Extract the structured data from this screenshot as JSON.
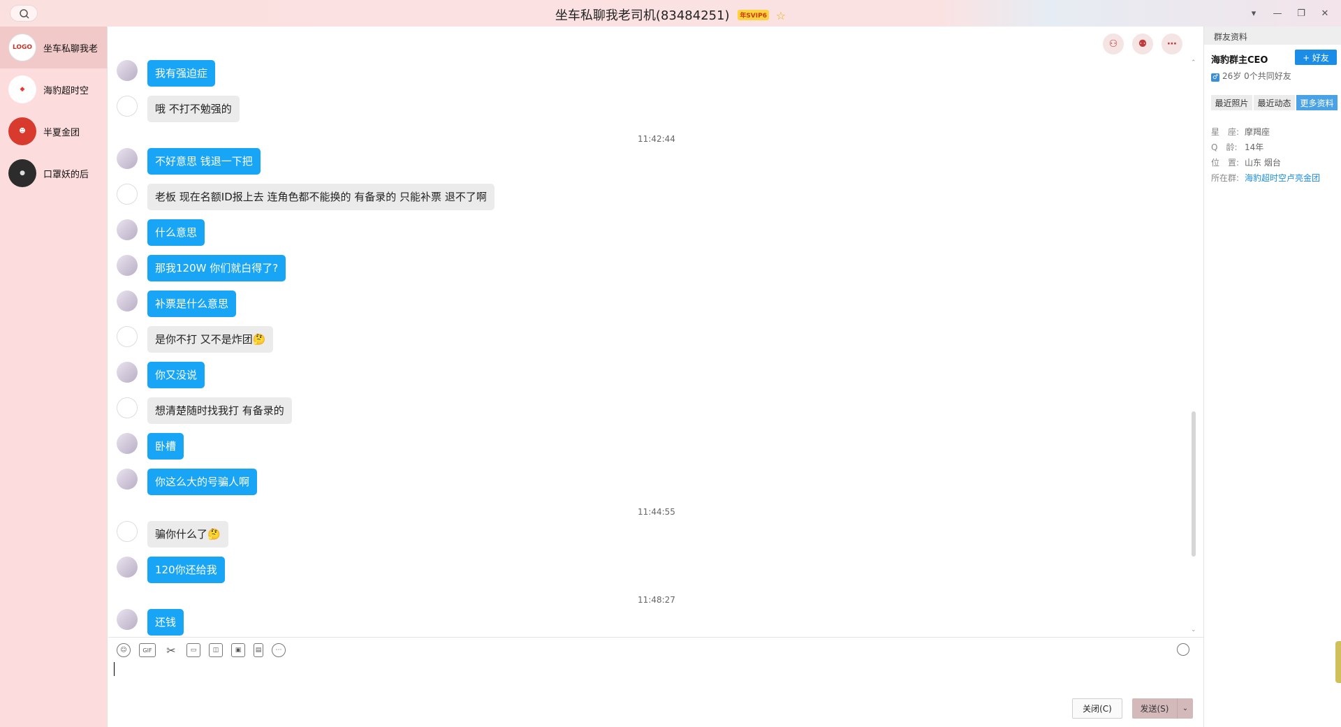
{
  "window": {
    "title": "坐车私聊我老司机(83484251)",
    "vip_badge": "年SVIP6",
    "controls": [
      "▾",
      "—",
      "❐",
      "✕"
    ]
  },
  "contacts": [
    {
      "name": "坐车私聊我老",
      "avatar_text": "LOGO",
      "active": true
    },
    {
      "name": "海豹超时空",
      "avatar_text": "◆",
      "active": false
    },
    {
      "name": "半夏金团",
      "avatar_text": "☻",
      "active": false
    },
    {
      "name": "口罩妖的后",
      "avatar_text": "●",
      "active": false
    }
  ],
  "messages": [
    {
      "side": "me",
      "text": "我有强迫症"
    },
    {
      "side": "them",
      "text": "哦 不打不勉强的"
    },
    {
      "time": "11:42:44"
    },
    {
      "side": "me",
      "text": "不好意思 钱退一下把"
    },
    {
      "side": "them",
      "text": "老板 现在名额ID报上去 连角色都不能换的  有备录的 只能补票 退不了啊"
    },
    {
      "side": "me",
      "text": "什么意思"
    },
    {
      "side": "me",
      "text": "那我120W 你们就白得了?"
    },
    {
      "side": "me",
      "text": "补票是什么意思"
    },
    {
      "side": "them",
      "text": "是你不打 又不是炸团🤔"
    },
    {
      "side": "me",
      "text": "你又没说"
    },
    {
      "side": "them",
      "text": "想清楚随时找我打 有备录的"
    },
    {
      "side": "me",
      "text": "卧槽"
    },
    {
      "side": "me",
      "text": "你这么大的号骗人啊"
    },
    {
      "time": "11:44:55"
    },
    {
      "side": "them",
      "text": "骗你什么了🤔"
    },
    {
      "side": "me",
      "text": "120你还给我"
    },
    {
      "time": "11:48:27"
    },
    {
      "side": "me",
      "text": "还钱"
    }
  ],
  "input": {
    "close_label": "关闭(C)",
    "send_label": "发送(S)",
    "toolbar": [
      "☺",
      "GIF",
      "✂",
      "▭",
      "◫",
      "▣",
      "▤",
      "⋯"
    ]
  },
  "profile": {
    "header": "群友资料",
    "name": "海豹群主CEO",
    "add_friend": "+ 好友",
    "meta": "26岁 0个共同好友",
    "gender": "♂",
    "tabs": [
      "最近照片",
      "最近动态",
      "更多资料"
    ],
    "active_tab": 2,
    "fields": [
      {
        "label": "星　座:",
        "value": "摩羯座"
      },
      {
        "label": "Q　龄:",
        "value": "14年"
      },
      {
        "label": "位　置:",
        "value": "山东 烟台"
      },
      {
        "label": "所在群:",
        "value": "海豹超时空卢亮金团",
        "link": true
      }
    ]
  }
}
